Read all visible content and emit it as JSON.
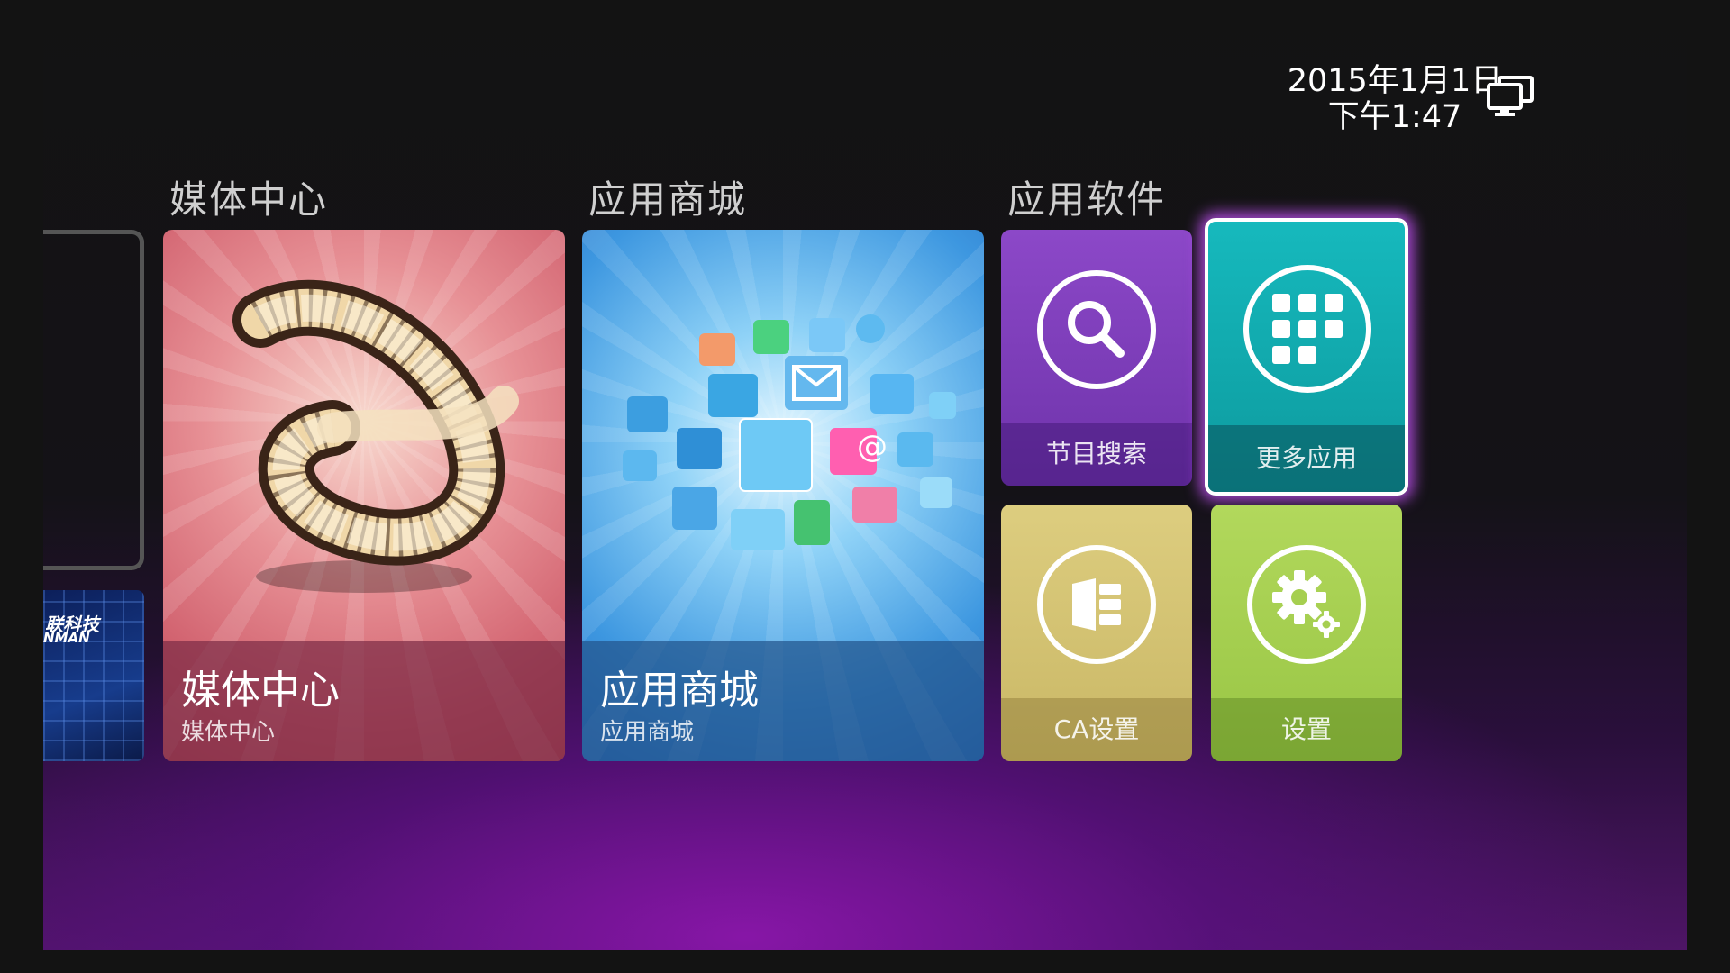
{
  "status": {
    "date": "2015年1月1日",
    "time": "下午1:47",
    "display_icon": "monitor-icon"
  },
  "sections": {
    "media": "媒体中心",
    "store": "应用商城",
    "apps": "应用软件"
  },
  "cards": {
    "media_center": {
      "title": "媒体中心",
      "subtitle": "媒体中心",
      "icon": "film-reel-icon"
    },
    "app_store": {
      "title": "应用商城",
      "subtitle": "应用商城",
      "icon": "app-cloud-icon"
    },
    "program_search": {
      "label": "节目搜索",
      "icon": "search-icon",
      "color": "#7b3fb6"
    },
    "more_apps": {
      "label": "更多应用",
      "icon": "grid-icon",
      "color": "#12a9ad",
      "focused": true
    },
    "ca_settings": {
      "label": "CA设置",
      "icon": "ca-card-icon",
      "color": "#d4c36f"
    },
    "settings": {
      "label": "设置",
      "icon": "gear-icon",
      "color": "#a3cd4d"
    }
  },
  "partial": {
    "brand_cn": "联科技",
    "brand_en": "NMAN"
  },
  "colors": {
    "focus_glow": "#b64fe8",
    "background_purple": "#5a157a"
  }
}
